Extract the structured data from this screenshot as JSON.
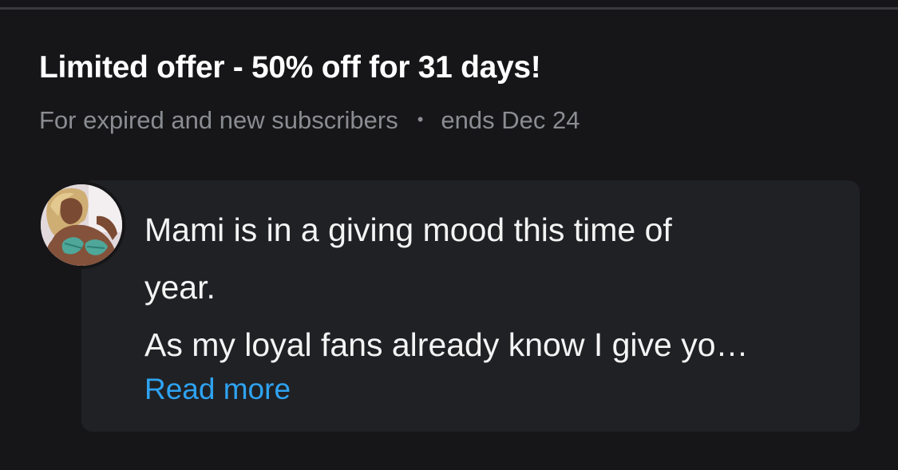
{
  "offer": {
    "title": "Limited offer - 50% off for 31 days!",
    "audience": "For expired and new subscribers",
    "separator": "•",
    "ends": "ends Dec 24"
  },
  "message": {
    "line1": "Mami is in a giving mood this time of\nyear.\nAs my loyal fans already know I give yo…",
    "read_more": "Read more"
  },
  "colors": {
    "background": "#161618",
    "card": "#202124",
    "link": "#2ea3f2",
    "muted_text": "#8a8c92"
  }
}
